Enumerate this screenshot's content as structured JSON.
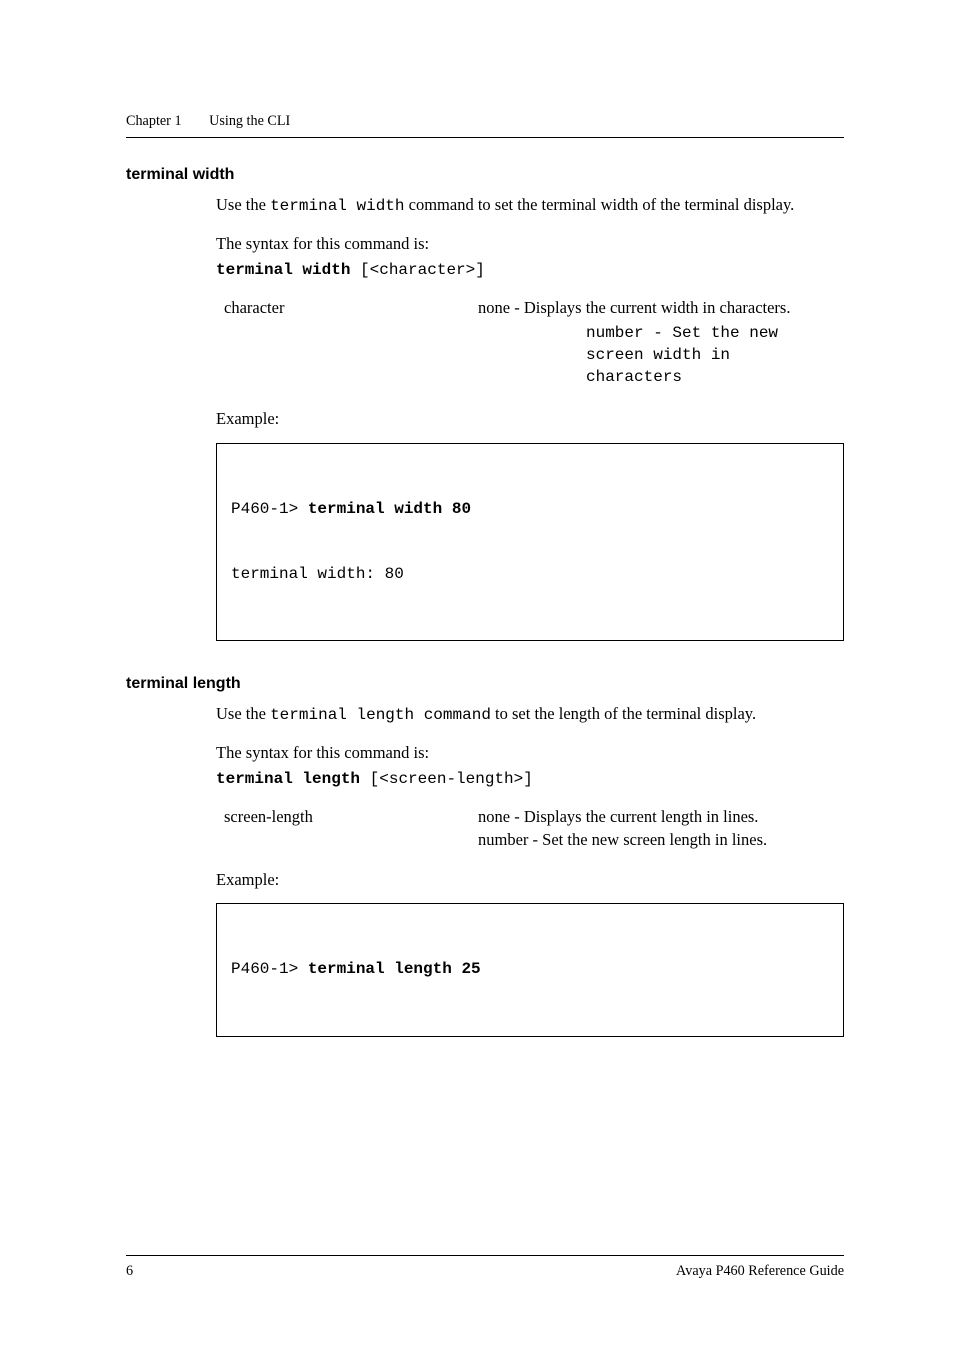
{
  "header": {
    "chapter_label": "Chapter 1",
    "chapter_title": "Using the CLI"
  },
  "sections": {
    "terminal_width": {
      "heading": "terminal width",
      "intro_pre": "Use the ",
      "intro_cmd": "terminal width",
      "intro_post": " command to set the terminal width  of the terminal display.",
      "syntax_label": "The syntax for this command is:",
      "syntax_cmd_bold": "terminal width",
      "syntax_cmd_rest": " [<character>]",
      "param_name": "character",
      "param_desc": "none - Displays the current width in characters.",
      "param_sub": "number - Set the new\nscreen width in\ncharacters",
      "example_label": "Example:",
      "code_prompt": "P460-1> ",
      "code_cmd": "terminal width 80",
      "code_out": "terminal width: 80"
    },
    "terminal_length": {
      "heading": "terminal length",
      "intro_pre": "Use the ",
      "intro_cmd": "terminal length command",
      "intro_post": " to set the length of the terminal display.",
      "syntax_label": "The syntax for this command is:",
      "syntax_cmd_bold": "terminal length",
      "syntax_cmd_rest": " [<screen-length>]",
      "param_name": "screen-length",
      "param_desc_1": "none - Displays the current length in lines.",
      "param_desc_2": "number - Set the new screen length in lines.",
      "example_label": "Example:",
      "code_prompt": "P460-1> ",
      "code_cmd": "terminal length 25"
    }
  },
  "footer": {
    "page_number": "6",
    "doc_title": "Avaya P460 Reference Guide"
  }
}
